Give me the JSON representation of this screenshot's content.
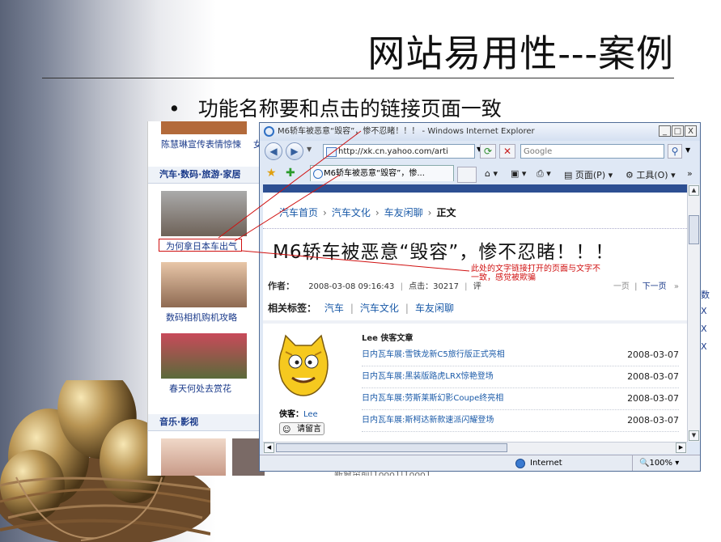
{
  "slide": {
    "title": "网站易用性---案例",
    "bullet": "功能名称要和点击的链接页面一致"
  },
  "bg_page": {
    "caption_top": "陈慧琳宣传表情惊悚",
    "caption_top_right": "女",
    "section_auto": "汽车·数码·旅游·家居",
    "car_caption": "为何拿日本车出气",
    "camera_caption": "数码相机购机攻略",
    "flower_caption": "春天何处去赏花",
    "section_music": "音乐·影视",
    "bottom_links": "新窗帘前|1ooo1|1ooo1"
  },
  "ie": {
    "window_title": "M6轿车被恶意“毁容”，惨不忍睹！！！ - Windows Internet Explorer",
    "min_btn": "_",
    "max_btn": "□",
    "close_btn": "X",
    "address": "http://xk.cn.yahoo.com/arti",
    "search_placeholder": "Google",
    "tab_title": "M6轿车被恶意“毁容”，惨...",
    "cmd_page": "页面(P)",
    "cmd_tools": "工具(O)",
    "status_zone": "Internet",
    "zoom": "100%"
  },
  "article": {
    "breadcrumb": [
      "汽车首页",
      "汽车文化",
      "车友闲聊"
    ],
    "breadcrumb_current": "正文",
    "headline": "M6轿车被恶意“毁容”，惨不忍睹！！！",
    "author_label": "作者：",
    "datetime": "2008-03-08 09:16:43",
    "clicks": "点击：30217",
    "comment_cut": "评",
    "prev": "一页",
    "next": "下一页",
    "tags_label": "相关标签：",
    "tags": [
      "汽车",
      "汽车文化",
      "车友闲聊"
    ],
    "blogger_label": "侠客：",
    "blogger_name": "Lee",
    "message_btn": "请留言",
    "blog_title": "Lee 侠客文章",
    "blog_posts": [
      {
        "title": "日内瓦车展:雪铁龙新C5旅行版正式亮相",
        "date": "2008-03-07"
      },
      {
        "title": "日内瓦车展:黑装版路虎LRX惊艳登场",
        "date": "2008-03-07"
      },
      {
        "title": "日内瓦车展:劳斯莱斯幻影Coupe终亮相",
        "date": "2008-03-07"
      },
      {
        "title": "日内瓦车展:斯柯达新款速派闪耀登场",
        "date": "2008-03-07"
      }
    ]
  },
  "annotation": "此处的文字链接打开的页面与文字不一致，感觉被欺骗",
  "right_edge_links": [
    "数",
    "X",
    "X",
    "X"
  ]
}
